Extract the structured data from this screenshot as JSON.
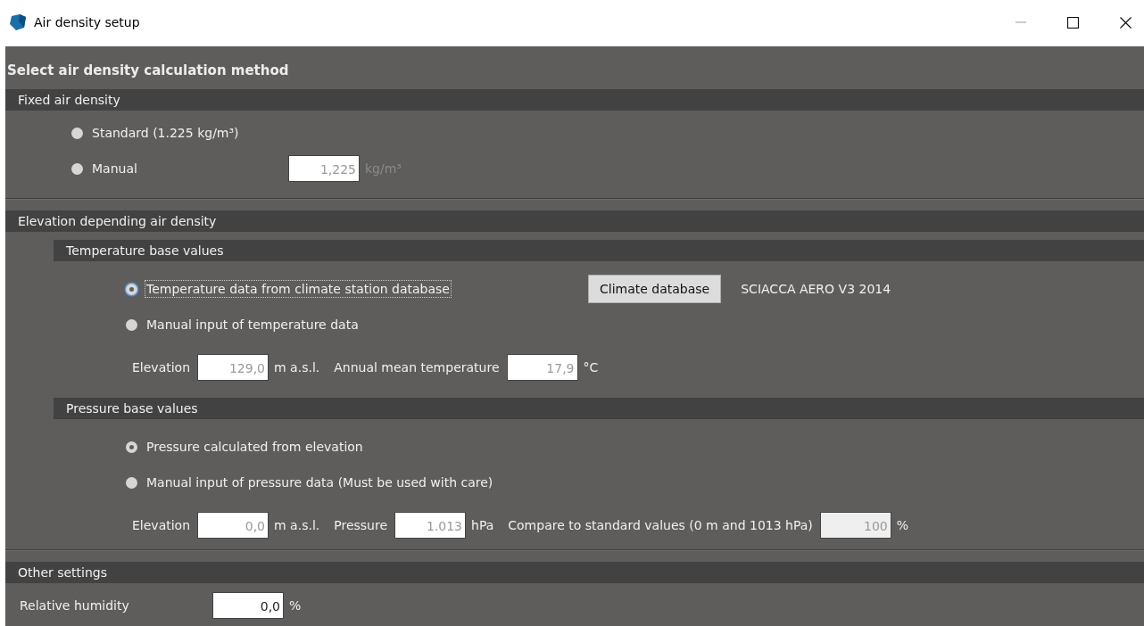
{
  "window": {
    "title": "Air density setup"
  },
  "heading": "Select air density calculation method",
  "fixed": {
    "title": "Fixed air density",
    "options": [
      {
        "label": "Standard (1.225 kg/m³)",
        "selected": false,
        "focused": false
      },
      {
        "label": "Manual",
        "selected": false,
        "focused": false,
        "field": {
          "value": "1,225",
          "unit": "kg/m³",
          "disabled": true,
          "readonly": false,
          "unit_greyed": true
        }
      }
    ]
  },
  "elevation": {
    "title": "Elevation depending air density",
    "groups": [
      {
        "title": "Temperature base values",
        "options": [
          {
            "label": "Temperature data from climate station database",
            "selected": true,
            "focused": true,
            "button": "Climate database",
            "station": "SCIACCA AERO V3 2014"
          },
          {
            "label": "Manual input of temperature data",
            "selected": false,
            "focused": false
          }
        ],
        "inputs": [
          {
            "label": "Elevation",
            "value": "129,0",
            "unit": "m a.s.l.",
            "disabled": true,
            "readonly": false,
            "unit_greyed": false
          },
          {
            "label": "Annual mean temperature",
            "value": "17,9",
            "unit": "°C",
            "disabled": true,
            "readonly": false,
            "unit_greyed": false
          }
        ]
      },
      {
        "title": "Pressure base values",
        "options": [
          {
            "label": "Pressure calculated from elevation",
            "selected": true,
            "focused": false
          },
          {
            "label": "Manual input of pressure data (Must be used with care)",
            "selected": false,
            "focused": false
          }
        ],
        "inputs": [
          {
            "label": "Elevation",
            "value": "0,0",
            "unit": "m a.s.l.",
            "disabled": true,
            "readonly": false,
            "unit_greyed": false
          },
          {
            "label": "Pressure",
            "value": "1.013",
            "unit": "hPa",
            "disabled": true,
            "readonly": false,
            "unit_greyed": false
          },
          {
            "label": "Compare to standard values (0 m and 1013 hPa)",
            "value": "100",
            "unit": "%",
            "disabled": true,
            "readonly": true,
            "unit_greyed": false
          }
        ]
      }
    ]
  },
  "other": {
    "title": "Other settings",
    "inputs": [
      {
        "label": "Relative humidity",
        "value": "0,0",
        "unit": "%",
        "disabled": false,
        "readonly": false,
        "unit_greyed": false
      }
    ]
  }
}
